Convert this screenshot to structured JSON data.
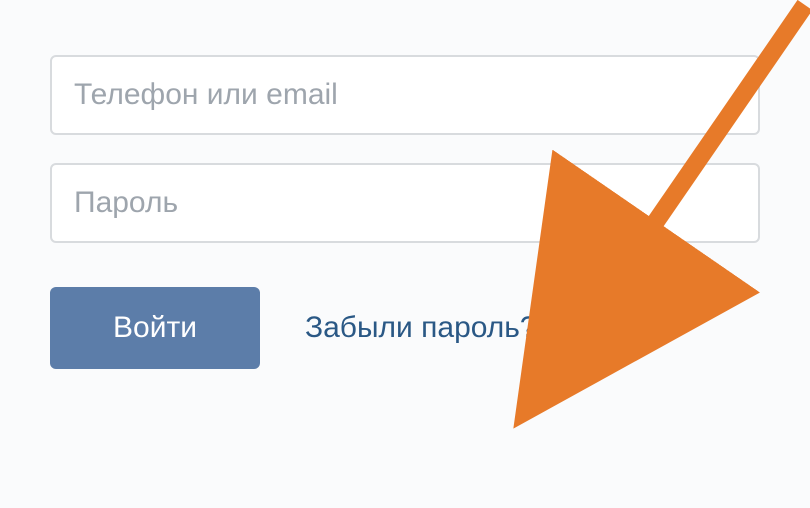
{
  "login": {
    "username_placeholder": "Телефон или email",
    "password_placeholder": "Пароль",
    "submit_label": "Войти",
    "forgot_label": "Забыли пароль?"
  },
  "colors": {
    "button_bg": "#5c7da9",
    "link": "#2a5885",
    "input_border": "#d8dbde",
    "placeholder": "#9ea5ad",
    "arrow": "#e77a29"
  }
}
